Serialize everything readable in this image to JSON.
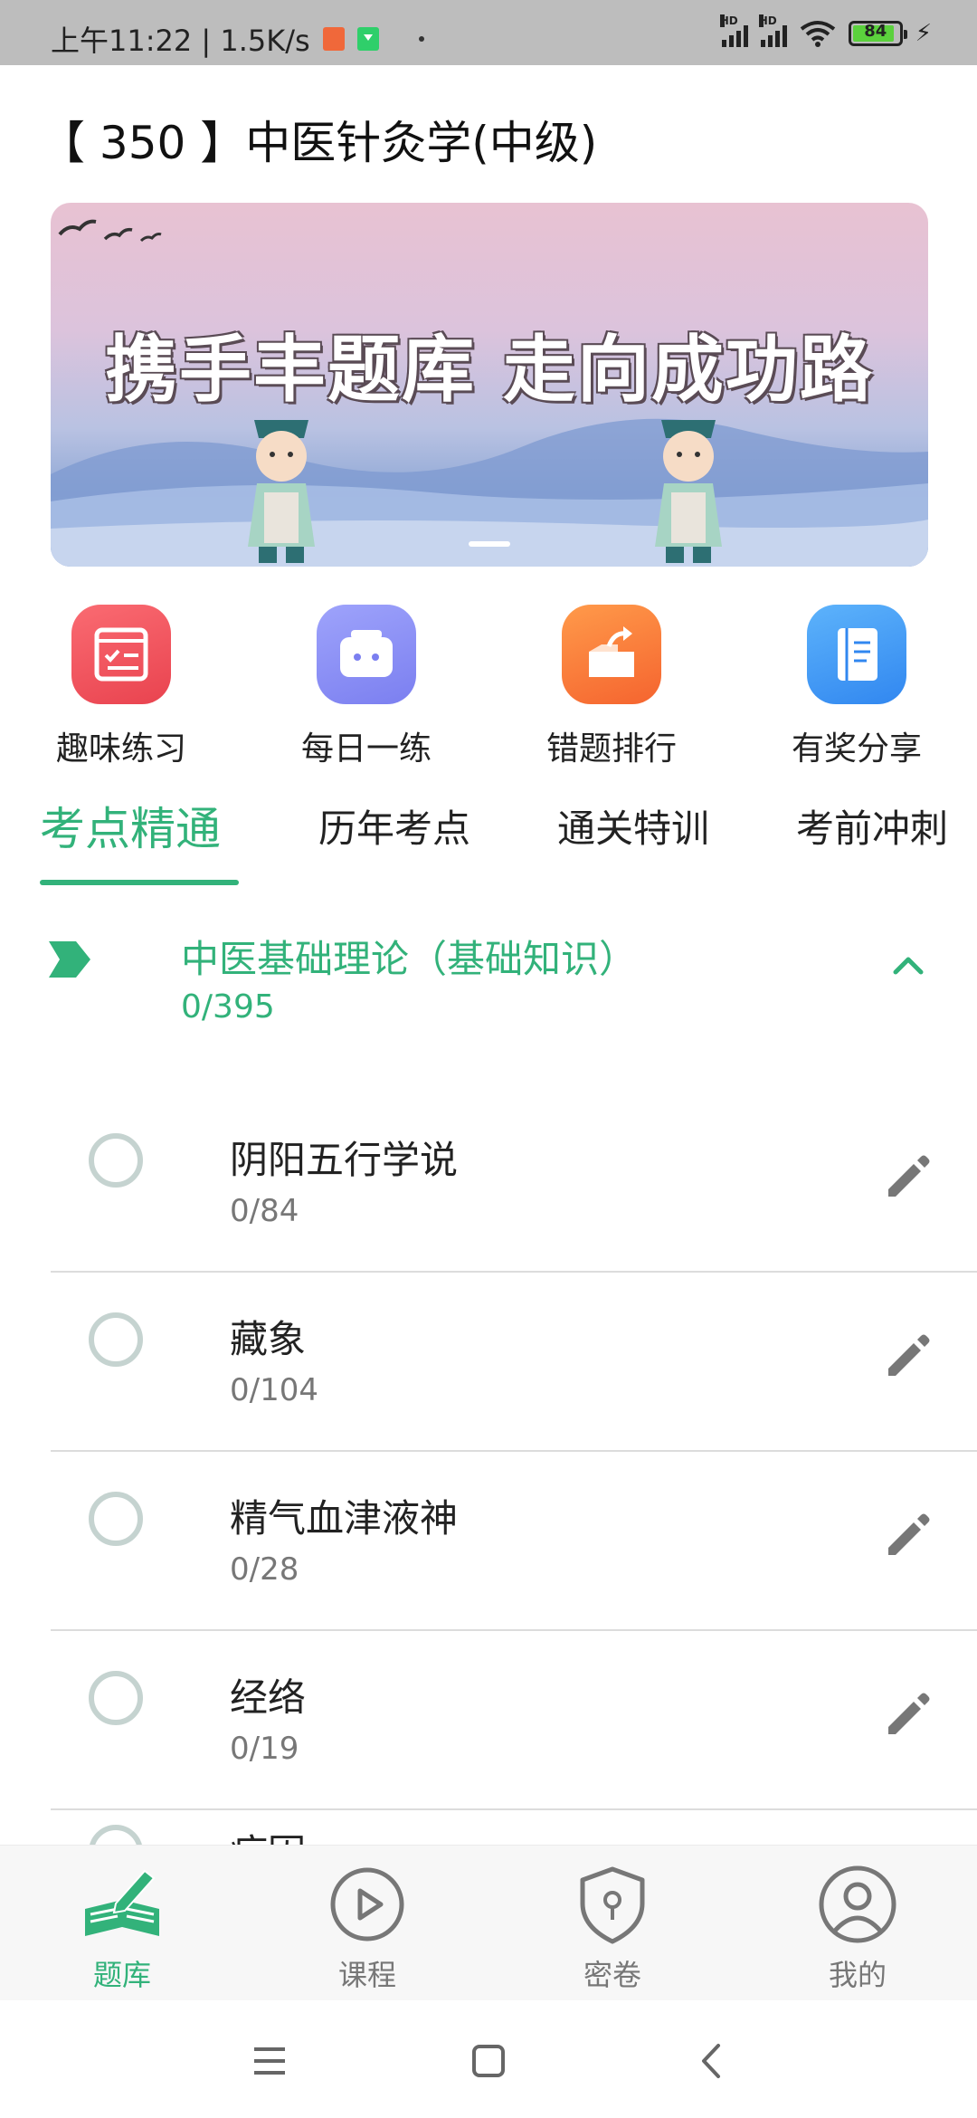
{
  "status_bar": {
    "time_speed": "上午11:22 | 1.5K/s",
    "battery_level": "84"
  },
  "page": {
    "title": "【 350 】中医针灸学(中级)"
  },
  "banner": {
    "text": "携手丰题库 走向成功路"
  },
  "quick_menu": [
    {
      "label": "趣味练习",
      "icon": "practice-icon",
      "color": "#f0525e"
    },
    {
      "label": "每日一练",
      "icon": "daily-icon",
      "color": "#8a8ff5"
    },
    {
      "label": "错题排行",
      "icon": "wrong-ranking-icon",
      "color": "#fb7a3c"
    },
    {
      "label": "有奖分享",
      "icon": "share-reward-icon",
      "color": "#3d9cf5"
    }
  ],
  "tabs": [
    {
      "label": "考点精通",
      "active": true
    },
    {
      "label": "历年考点",
      "active": false
    },
    {
      "label": "通关特训",
      "active": false
    },
    {
      "label": "考前冲刺",
      "active": false
    }
  ],
  "section": {
    "title": "中医基础理论（基础知识）",
    "count": "0/395"
  },
  "items": [
    {
      "title": "阴阳五行学说",
      "count": "0/84"
    },
    {
      "title": "藏象",
      "count": "0/104"
    },
    {
      "title": "精气血津液神",
      "count": "0/28"
    },
    {
      "title": "经络",
      "count": "0/19"
    },
    {
      "title": "病因",
      "count": ""
    }
  ],
  "bottom_nav": [
    {
      "label": "题库",
      "icon": "question-bank-icon",
      "active": true
    },
    {
      "label": "课程",
      "icon": "play-circle-icon",
      "active": false
    },
    {
      "label": "密卷",
      "icon": "shield-lock-icon",
      "active": false
    },
    {
      "label": "我的",
      "icon": "user-icon",
      "active": false
    }
  ],
  "colors": {
    "accent": "#32b27a",
    "text": "#222222",
    "muted": "#777777"
  }
}
